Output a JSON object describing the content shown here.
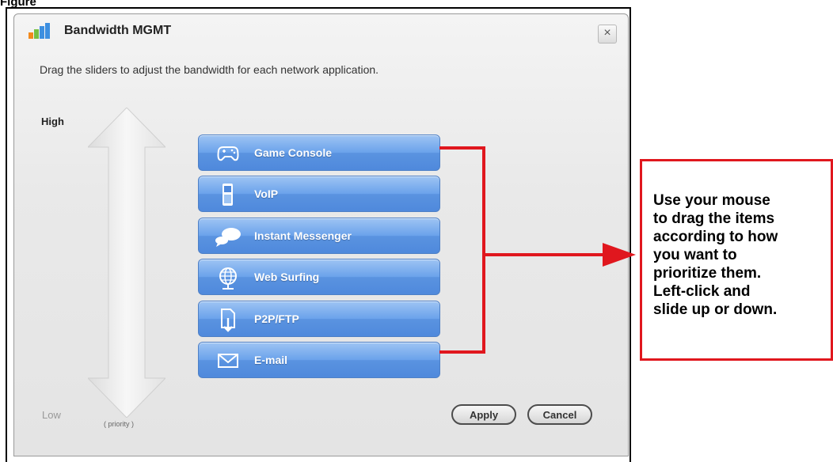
{
  "figure": {
    "label": "Figure"
  },
  "dialog": {
    "title": "Bandwidth MGMT",
    "close_label": "×",
    "instruction": "Drag the sliders to adjust the bandwidth for each network application."
  },
  "priority": {
    "high": "High",
    "low": "Low",
    "caption": "( priority )"
  },
  "apps": [
    {
      "label": "Game Console",
      "icon": "gamepad-icon"
    },
    {
      "label": "VoIP",
      "icon": "phone-icon"
    },
    {
      "label": "Instant Messenger",
      "icon": "chat-bubble-icon"
    },
    {
      "label": "Web Surfing",
      "icon": "globe-icon"
    },
    {
      "label": "P2P/FTP",
      "icon": "download-file-icon"
    },
    {
      "label": "E-mail",
      "icon": "envelope-icon"
    }
  ],
  "buttons": {
    "apply": "Apply",
    "cancel": "Cancel"
  },
  "callout": {
    "lines": [
      "Use your mouse",
      "to drag the items",
      "according to how",
      "you want to",
      "prioritize them.",
      "Left-click and",
      "slide up or down."
    ]
  },
  "colors": {
    "accent_red": "#e0171e",
    "button_blue": "#5a93e0"
  }
}
